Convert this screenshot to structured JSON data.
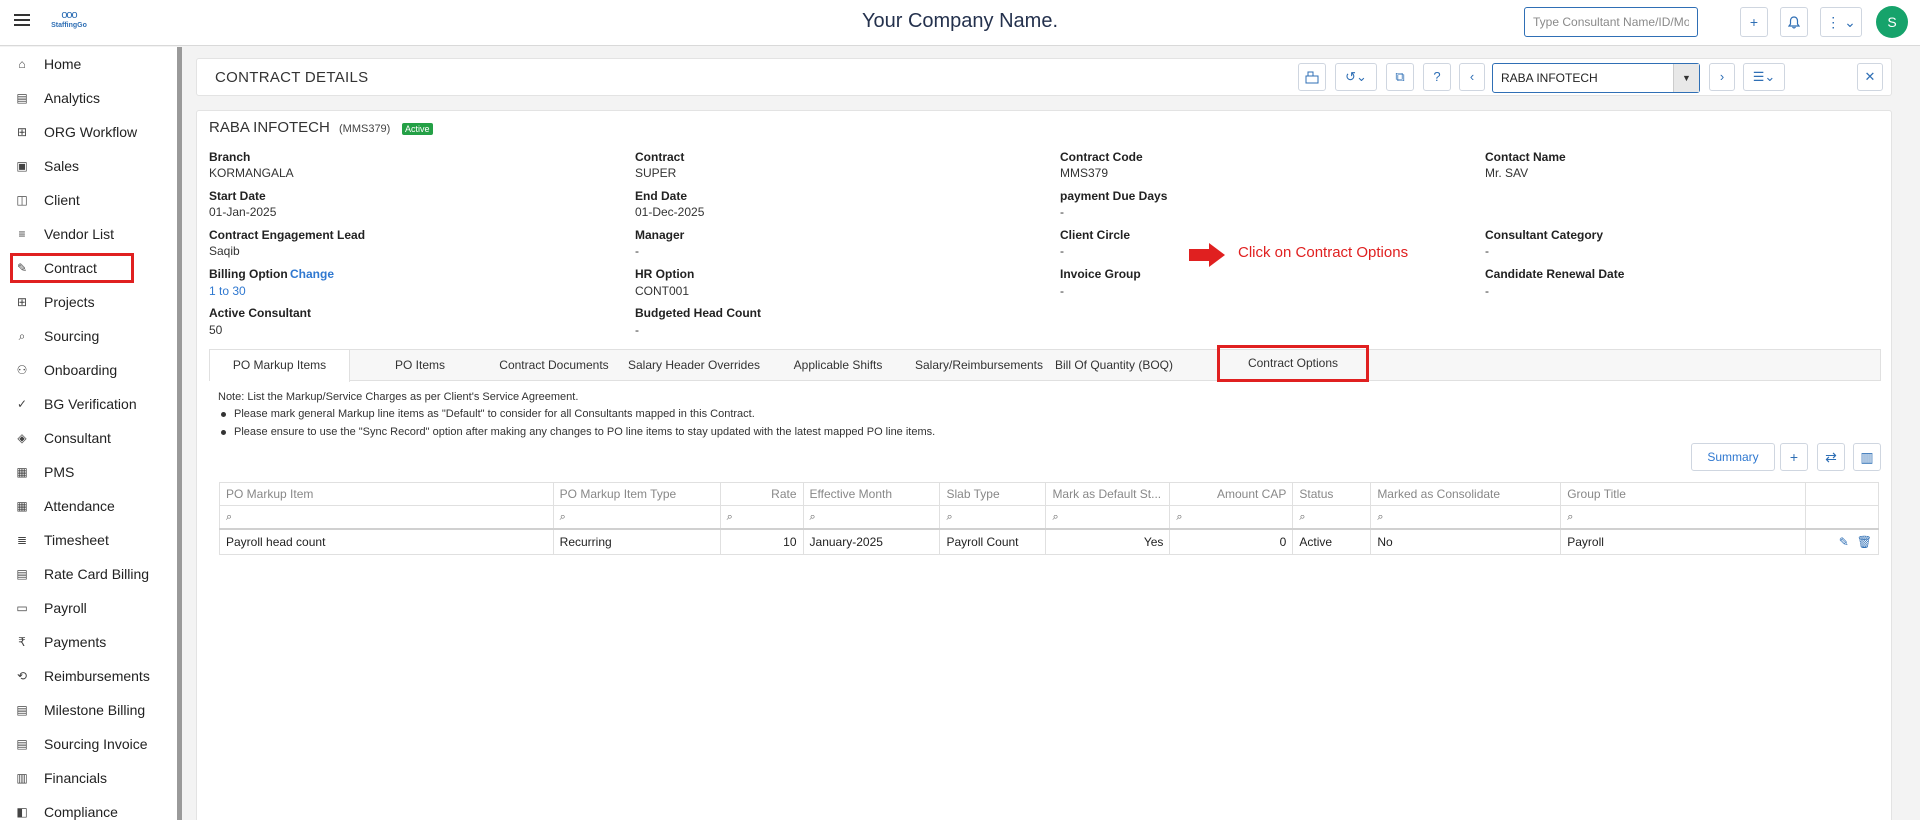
{
  "app": {
    "company_name": "Your Company Name.",
    "logo_word": "StaffingGo",
    "logo_rings": "ooo",
    "search_placeholder": "Type Consultant Name/ID/Mobile/...",
    "user_initial": "S",
    "accent_color": "#2f6fb5",
    "highlight_color": "#e02020"
  },
  "sidebar": {
    "items": [
      {
        "label": "Home",
        "icon": "home-icon"
      },
      {
        "label": "Analytics",
        "icon": "chart-icon"
      },
      {
        "label": "ORG Workflow",
        "icon": "workflow-icon"
      },
      {
        "label": "Sales",
        "icon": "briefcase-icon"
      },
      {
        "label": "Client",
        "icon": "client-icon"
      },
      {
        "label": "Vendor List",
        "icon": "vendor-list-icon"
      },
      {
        "label": "Contract",
        "icon": "contract-icon",
        "selected": true
      },
      {
        "label": "Projects",
        "icon": "grid-icon"
      },
      {
        "label": "Sourcing",
        "icon": "sourcing-icon"
      },
      {
        "label": "Onboarding",
        "icon": "onboarding-icon"
      },
      {
        "label": "BG Verification",
        "icon": "verification-icon"
      },
      {
        "label": "Consultant",
        "icon": "consultant-icon"
      },
      {
        "label": "PMS",
        "icon": "pms-icon"
      },
      {
        "label": "Attendance",
        "icon": "calendar-icon"
      },
      {
        "label": "Timesheet",
        "icon": "timesheet-icon"
      },
      {
        "label": "Rate Card Billing",
        "icon": "rate-card-icon"
      },
      {
        "label": "Payroll",
        "icon": "payroll-icon"
      },
      {
        "label": "Payments",
        "icon": "rupee-icon"
      },
      {
        "label": "Reimbursements",
        "icon": "reimbursement-icon"
      },
      {
        "label": "Milestone Billing",
        "icon": "milestone-icon"
      },
      {
        "label": "Sourcing Invoice",
        "icon": "invoice-icon"
      },
      {
        "label": "Financials",
        "icon": "financials-icon"
      },
      {
        "label": "Compliance",
        "icon": "compliance-icon"
      }
    ]
  },
  "header": {
    "title": "CONTRACT DETAILS",
    "selected_client": "RABA INFOTECH"
  },
  "contract": {
    "client_name": "RABA INFOTECH",
    "code_paren": "(MMS379)",
    "status": "Active",
    "fields": {
      "branch": {
        "label": "Branch",
        "value": "KORMANGALA"
      },
      "contract": {
        "label": "Contract",
        "value": "SUPER"
      },
      "contract_code": {
        "label": "Contract Code",
        "value": "MMS379"
      },
      "contact_name": {
        "label": "Contact Name",
        "value": "Mr. SAV"
      },
      "start_date": {
        "label": "Start Date",
        "value": "01-Jan-2025"
      },
      "end_date": {
        "label": "End Date",
        "value": "01-Dec-2025"
      },
      "payment_due_days": {
        "label": "payment Due Days",
        "value": "-"
      },
      "engagement_lead": {
        "label": "Contract Engagement Lead",
        "value": "Saqib"
      },
      "manager": {
        "label": "Manager",
        "value": "-"
      },
      "client_circle": {
        "label": "Client Circle",
        "value": "-"
      },
      "consultant_category": {
        "label": "Consultant Category",
        "value": "-"
      },
      "billing_option": {
        "label": "Billing Option",
        "value": "1 to 30",
        "action": "Change"
      },
      "hr_option": {
        "label": "HR Option",
        "value": "CONT001"
      },
      "invoice_group": {
        "label": "Invoice Group",
        "value": "-"
      },
      "candidate_renewal_date": {
        "label": "Candidate Renewal Date",
        "value": "-"
      },
      "active_consultant": {
        "label": "Active Consultant",
        "value": "50"
      },
      "budgeted_head_count": {
        "label": "Budgeted Head Count",
        "value": "-"
      }
    }
  },
  "tabs": [
    {
      "label": "PO Markup Items",
      "active": true
    },
    {
      "label": "PO Items"
    },
    {
      "label": "Contract Documents"
    },
    {
      "label": "Salary Header Overrides"
    },
    {
      "label": "Applicable Shifts"
    },
    {
      "label": "Salary/Reimbursements"
    },
    {
      "label": "Bill Of Quantity (BOQ)"
    },
    {
      "label": "Contract Options",
      "highlighted": true
    }
  ],
  "annotation": "Click on Contract Options",
  "notes": {
    "heading": "Note: List the Markup/Service Charges as per Client's Service Agreement.",
    "bullets": [
      "Please mark general Markup line items as \"Default\" to consider for all Consultants mapped in this Contract.",
      "Please ensure to use the \"Sync Record\" option after making any changes to PO line items to stay updated with the latest mapped PO line items."
    ]
  },
  "table": {
    "summary_label": "Summary",
    "columns": [
      "PO Markup Item",
      "PO Markup Item Type",
      "Rate",
      "Effective Month",
      "Slab Type",
      "Mark as Default St...",
      "Amount CAP",
      "Status",
      "Marked as Consolidate",
      "Group Title"
    ],
    "rows": [
      [
        "Payroll head count",
        "Recurring",
        "10",
        "January-2025",
        "Payroll Count",
        "Yes",
        "0",
        "Active",
        "No",
        "Payroll"
      ]
    ]
  }
}
